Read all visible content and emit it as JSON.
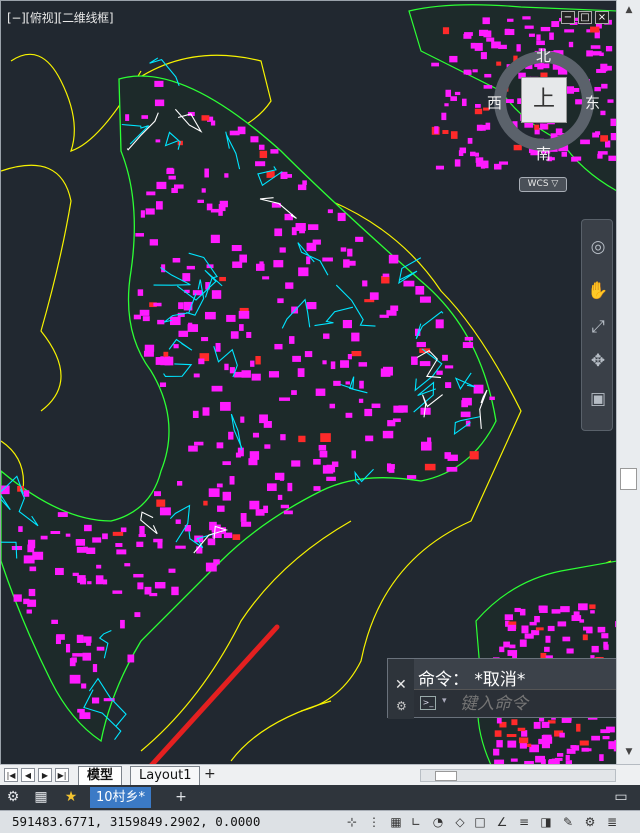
{
  "viewport": {
    "label": "[−][俯视][二维线框]",
    "viewcube": {
      "face": "上",
      "north": "北",
      "south": "南",
      "east": "东",
      "west": "西"
    },
    "wcs_label": "WCS ▽",
    "controls": {
      "minimize": "−",
      "restore": "□",
      "close": "×"
    }
  },
  "command_window": {
    "history_line": "命令： *取消*",
    "input_placeholder": "键入命令",
    "prompt_icon": ">_"
  },
  "layout_tabs": {
    "nav": [
      "|◀",
      "◀",
      "▶",
      "▶|"
    ],
    "tabs": [
      "模型",
      "Layout1"
    ],
    "add": "+"
  },
  "file_tabs": {
    "active_file": "10村乡*",
    "add": "+"
  },
  "status_bar": {
    "coordinates": "591483.6771, 3159849.2902, 0.0000"
  },
  "icons": {
    "settings": "gear-icon",
    "workspace": "grid-icon",
    "favorite": "star-icon"
  },
  "colors": {
    "canvas_bg": "#212830",
    "parcel_magenta": "#ff1bff",
    "road_cyan": "#00e5ff",
    "contour_yellow": "#f7f300",
    "vegetation_green": "#2cff34",
    "annotation_red": "#ff2a2a",
    "arrow_red": "#e42020",
    "file_tab_blue": "#3b7ac6"
  }
}
